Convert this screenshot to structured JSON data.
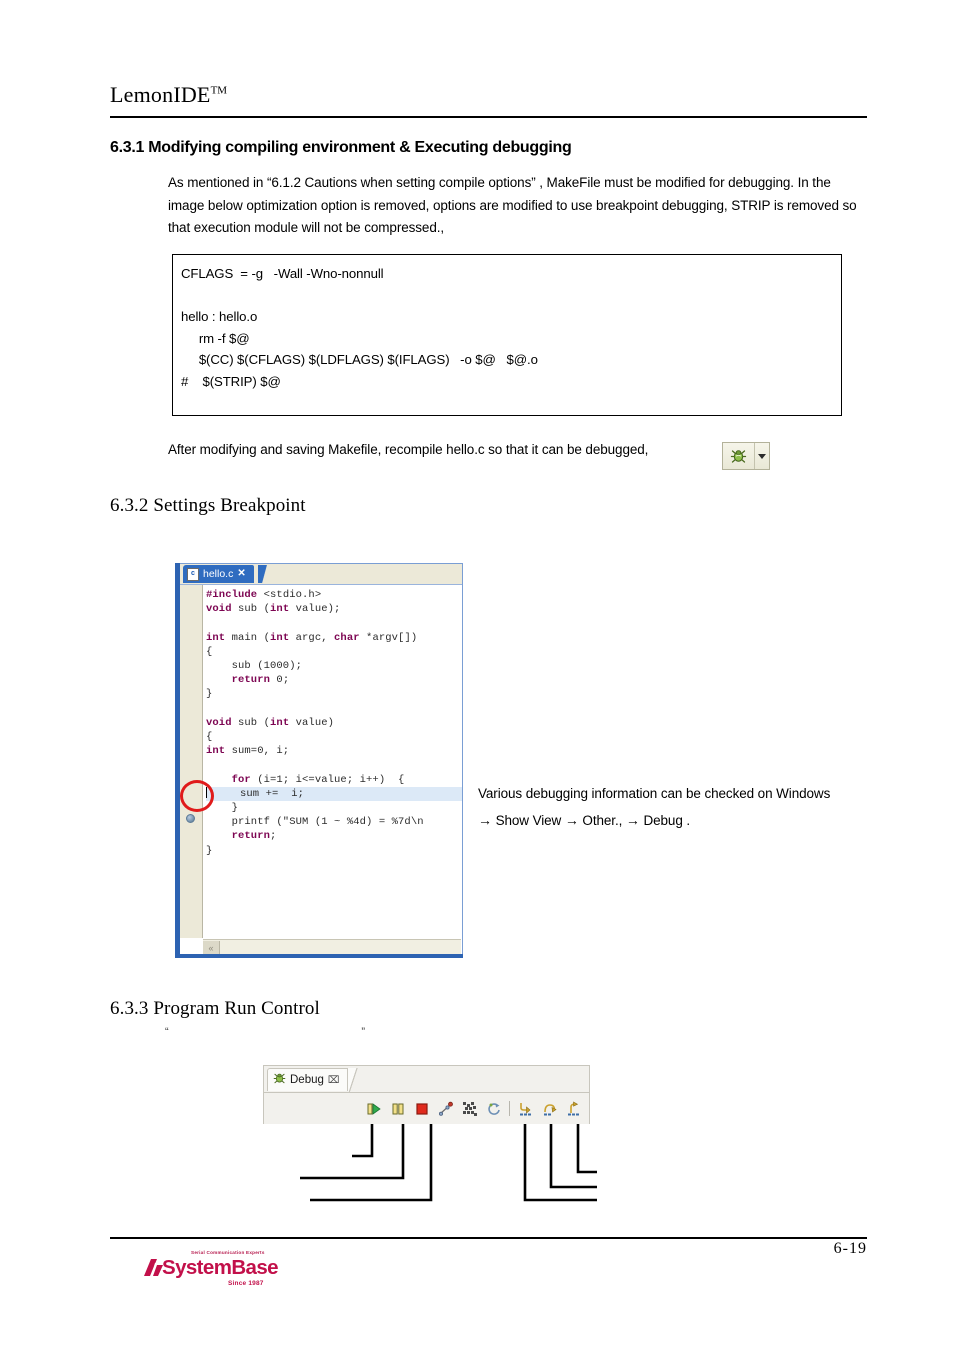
{
  "header": {
    "doc_title": "LemonIDE",
    "doc_title_sup": "TM"
  },
  "section_631": {
    "heading": "6.3.1 Modifying compiling environment & Executing debugging",
    "paragraph": "As mentioned in  “6.1.2 Cautions when setting compile options” , MakeFile must be modified for debugging. In the image below optimization option is removed, options are modified to use breakpoint debugging, STRIP is removed so that execution module will not be compressed.,",
    "code_block": [
      "CFLAGS  = -g   -Wall -Wno-nonnull",
      "",
      "hello : hello.o",
      "     rm -f $@",
      "     $(CC) $(CFLAGS) $(LDFLAGS) $(IFLAGS)   -o $@   $@.o",
      "#    $(STRIP) $@"
    ],
    "after_text": "After modifying and saving Makefile, recompile hello.c so that it can be debugged,",
    "debug_button": {
      "icon": "bug-icon",
      "dropdown": "chevron-down-icon"
    }
  },
  "section_632": {
    "heading": "6.3.2 Settings Breakpoint",
    "editor": {
      "tab_label": "hello.c",
      "tab_close": "✕",
      "file_icon_letter": "c",
      "breakpoint_marker": "breakpoint-dot",
      "scroll_left_arrow": "«",
      "code_lines": [
        {
          "indent": 0,
          "tokens": [
            {
              "t": "pp",
              "s": "#include"
            },
            {
              "t": "pl",
              "s": " <stdio.h>"
            }
          ]
        },
        {
          "indent": 0,
          "tokens": [
            {
              "t": "kw",
              "s": "void"
            },
            {
              "t": "pl",
              "s": " sub ("
            },
            {
              "t": "kw",
              "s": "int"
            },
            {
              "t": "pl",
              "s": " value);"
            }
          ]
        },
        {
          "indent": 0,
          "tokens": [
            {
              "t": "pl",
              "s": ""
            }
          ]
        },
        {
          "indent": 0,
          "tokens": [
            {
              "t": "kw",
              "s": "int"
            },
            {
              "t": "pl",
              "s": " main ("
            },
            {
              "t": "kw",
              "s": "int"
            },
            {
              "t": "pl",
              "s": " argc, "
            },
            {
              "t": "kw",
              "s": "char"
            },
            {
              "t": "pl",
              "s": " *argv[])"
            }
          ]
        },
        {
          "indent": 0,
          "tokens": [
            {
              "t": "pl",
              "s": "{"
            }
          ]
        },
        {
          "indent": 0,
          "tokens": [
            {
              "t": "pl",
              "s": "    sub (1000);"
            }
          ]
        },
        {
          "indent": 0,
          "tokens": [
            {
              "t": "pl",
              "s": "    "
            },
            {
              "t": "kw",
              "s": "return"
            },
            {
              "t": "pl",
              "s": " 0;"
            }
          ]
        },
        {
          "indent": 0,
          "tokens": [
            {
              "t": "pl",
              "s": "}"
            }
          ]
        },
        {
          "indent": 0,
          "tokens": [
            {
              "t": "pl",
              "s": ""
            }
          ]
        },
        {
          "indent": 0,
          "tokens": [
            {
              "t": "kw",
              "s": "void"
            },
            {
              "t": "pl",
              "s": " sub ("
            },
            {
              "t": "kw",
              "s": "int"
            },
            {
              "t": "pl",
              "s": " value)"
            }
          ]
        },
        {
          "indent": 0,
          "tokens": [
            {
              "t": "pl",
              "s": "{"
            }
          ]
        },
        {
          "indent": 0,
          "tokens": [
            {
              "t": "kw",
              "s": "int"
            },
            {
              "t": "pl",
              "s": " sum=0, i;"
            }
          ]
        },
        {
          "indent": 0,
          "tokens": [
            {
              "t": "pl",
              "s": ""
            }
          ]
        },
        {
          "indent": 0,
          "tokens": [
            {
              "t": "pl",
              "s": "    "
            },
            {
              "t": "kw",
              "s": "for"
            },
            {
              "t": "pl",
              "s": " (i=1; i<=value; i++)  {"
            }
          ]
        },
        {
          "indent": 0,
          "highlight": true,
          "caret": true,
          "tokens": [
            {
              "t": "pl",
              "s": "     sum +=  i;"
            }
          ]
        },
        {
          "indent": 0,
          "tokens": [
            {
              "t": "pl",
              "s": "    }"
            }
          ]
        },
        {
          "indent": 0,
          "tokens": [
            {
              "t": "pl",
              "s": "    printf (\"SUM (1 ~ %4d) = %7d\\n"
            }
          ]
        },
        {
          "indent": 0,
          "tokens": [
            {
              "t": "pl",
              "s": "    "
            },
            {
              "t": "kw",
              "s": "return"
            },
            {
              "t": "pl",
              "s": ";"
            }
          ]
        },
        {
          "indent": 0,
          "tokens": [
            {
              "t": "pl",
              "s": "}"
            }
          ]
        }
      ]
    },
    "note_line1": "Various debugging information can be checked on  Windows",
    "note_line2_parts": [
      "→",
      "Show View",
      "→",
      "Other.,",
      "→",
      "Debug ."
    ]
  },
  "section_633": {
    "heading": "6.3.3 Program Run Control",
    "quote_open": "“",
    "quote_close": "”",
    "debug_view": {
      "tab_label": "Debug",
      "tab_icon": "debug-bug-icon",
      "tab_maximize": "⌧",
      "toolbar_icons": [
        "resume-icon",
        "suspend-icon",
        "terminate-icon",
        "disconnect-icon",
        "remove-all-terminated-icon",
        "relaunch-icon",
        "step-into-icon",
        "step-over-icon",
        "step-return-icon"
      ]
    }
  },
  "footer": {
    "page_number": "6-19",
    "logo_tagline": "Serial Communication Experts",
    "logo_name": "SystemBase",
    "logo_since": "Since 1987",
    "logo_color": "#c2104a"
  }
}
